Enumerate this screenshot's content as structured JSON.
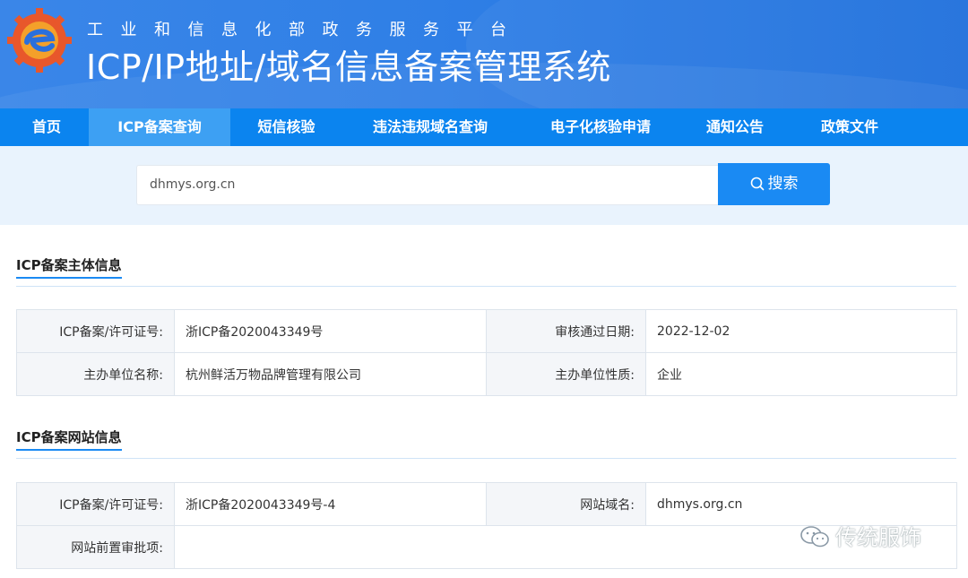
{
  "header": {
    "subtitle": "工业和信息化部政务服务平台",
    "title": "ICP/IP地址/域名信息备案管理系统"
  },
  "nav": {
    "items": [
      {
        "label": "首页"
      },
      {
        "label": "ICP备案查询"
      },
      {
        "label": "短信核验"
      },
      {
        "label": "违法违规域名查询"
      },
      {
        "label": "电子化核验申请"
      },
      {
        "label": "通知公告"
      },
      {
        "label": "政策文件"
      }
    ],
    "active_index": 1
  },
  "search": {
    "value": "dhmys.org.cn",
    "button_label": "搜索"
  },
  "subject_section": {
    "title": "ICP备案主体信息",
    "rows": [
      {
        "label1": "ICP备案/许可证号:",
        "value1": "浙ICP备2020043349号",
        "label2": "审核通过日期:",
        "value2": "2022-12-02"
      },
      {
        "label1": "主办单位名称:",
        "value1": "杭州鲜活万物品牌管理有限公司",
        "label2": "主办单位性质:",
        "value2": "企业"
      }
    ]
  },
  "website_section": {
    "title": "ICP备案网站信息",
    "rows": [
      {
        "label1": "ICP备案/许可证号:",
        "value1": "浙ICP备2020043349号-4",
        "label2": "网站域名:",
        "value2": "dhmys.org.cn"
      },
      {
        "label1": "网站前置审批项:",
        "value1": ""
      }
    ]
  },
  "watermark": {
    "text": "传统服饰"
  },
  "colors": {
    "header": "#2f7fe6",
    "nav": "#0b84ef",
    "nav_active": "#3da0f3",
    "search_band": "#e9f3fd",
    "search_button": "#1a8af3"
  }
}
